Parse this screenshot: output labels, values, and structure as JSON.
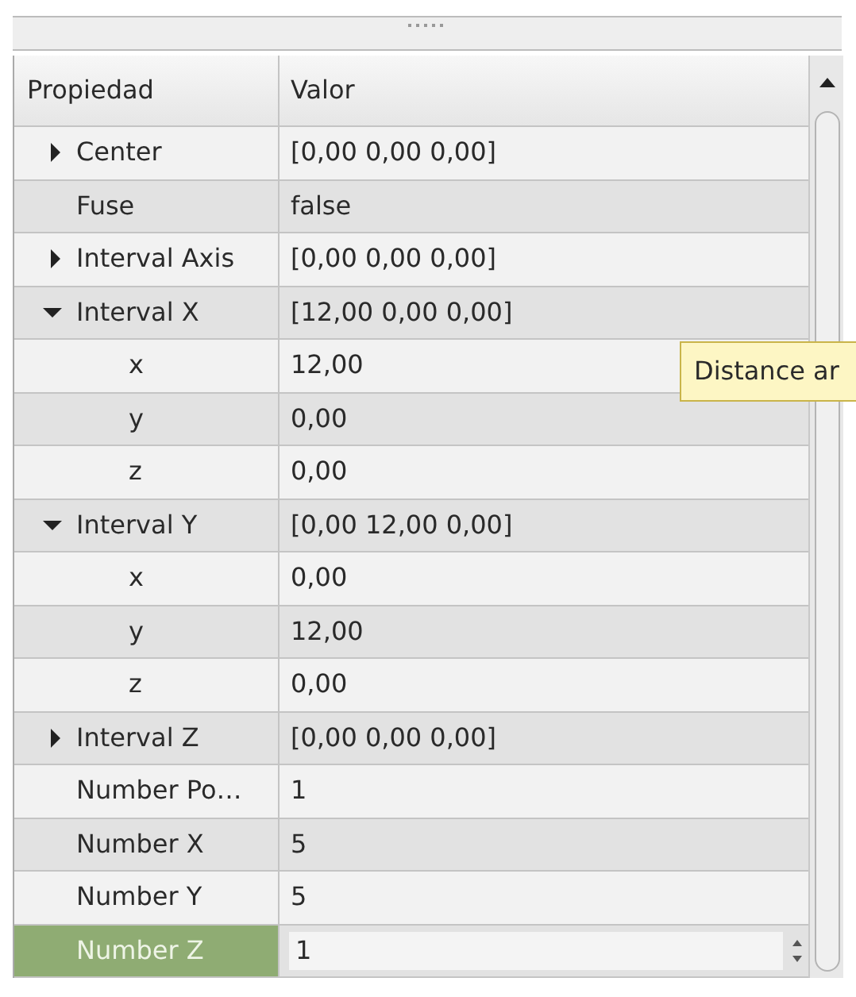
{
  "table": {
    "columns": [
      "Propiedad",
      "Valor"
    ],
    "rows": [
      {
        "name": "Center",
        "value": "[0,00 0,00 0,00]",
        "expanded": false,
        "selected": false,
        "kind": "text"
      },
      {
        "name": "Fuse",
        "value": "false",
        "selected": false,
        "kind": "text"
      },
      {
        "name": "Interval Axis",
        "value": "[0,00 0,00 0,00]",
        "expanded": false,
        "selected": false,
        "kind": "text"
      },
      {
        "name": "Interval X",
        "value": "[12,00 0,00 0,00]",
        "expanded": true,
        "selected": false,
        "kind": "text",
        "children": [
          {
            "name": "x",
            "value": "12,00",
            "selected": false,
            "kind": "text"
          },
          {
            "name": "y",
            "value": "0,00",
            "selected": false,
            "kind": "text"
          },
          {
            "name": "z",
            "value": "0,00",
            "selected": false,
            "kind": "text"
          }
        ]
      },
      {
        "name": "Interval Y",
        "value": "[0,00 12,00 0,00]",
        "expanded": true,
        "selected": false,
        "kind": "text",
        "children": [
          {
            "name": "x",
            "value": "0,00",
            "selected": false,
            "kind": "text"
          },
          {
            "name": "y",
            "value": "12,00",
            "selected": false,
            "kind": "text"
          },
          {
            "name": "z",
            "value": "0,00",
            "selected": false,
            "kind": "text"
          }
        ]
      },
      {
        "name": "Interval Z",
        "value": "[0,00 0,00 0,00]",
        "expanded": false,
        "selected": false,
        "kind": "text"
      },
      {
        "name": "Number Po…",
        "value": "1",
        "selected": false,
        "kind": "text"
      },
      {
        "name": "Number X",
        "value": "5",
        "selected": false,
        "kind": "text"
      },
      {
        "name": "Number Y",
        "value": "5",
        "selected": false,
        "kind": "text"
      },
      {
        "name": "Number Z",
        "value": "1",
        "selected": true,
        "kind": "spinbox"
      }
    ]
  },
  "tooltip": {
    "text": "Distance ar"
  }
}
